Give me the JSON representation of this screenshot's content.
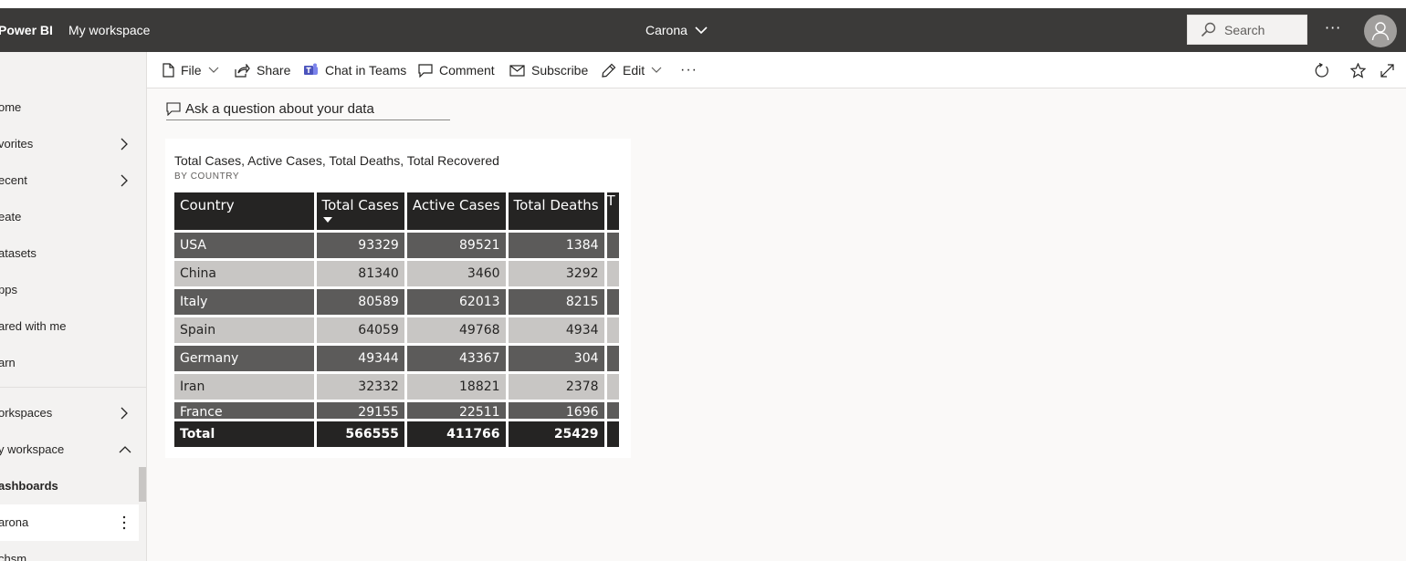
{
  "header": {
    "brand": "Power BI",
    "workspace": "My workspace",
    "report_title": "Carona",
    "search_placeholder": "Search",
    "more": "···"
  },
  "sidebar": {
    "items": [
      {
        "label": "ome"
      },
      {
        "label": "vorites"
      },
      {
        "label": "ecent"
      },
      {
        "label": "eate"
      },
      {
        "label": "atasets"
      },
      {
        "label": "pps"
      },
      {
        "label": "ared with me"
      },
      {
        "label": "arn"
      },
      {
        "label": "orkspaces"
      },
      {
        "label": "y workspace"
      },
      {
        "label": "ashboards"
      },
      {
        "label": "arona"
      },
      {
        "label": "chsm"
      }
    ]
  },
  "toolbar": {
    "file": "File",
    "share": "Share",
    "chat": "Chat in Teams",
    "comment": "Comment",
    "subscribe": "Subscribe",
    "edit": "Edit",
    "more": "···"
  },
  "qna": {
    "placeholder": "Ask a question about your data"
  },
  "tile": {
    "title": "Total Cases, Active Cases, Total Deaths, Total Recovered",
    "subtitle": "BY COUNTRY",
    "columns": [
      "Country",
      "Total Cases",
      "Active Cases",
      "Total Deaths",
      "T"
    ],
    "rows": [
      [
        "USA",
        "93329",
        "89521",
        "1384"
      ],
      [
        "China",
        "81340",
        "3460",
        "3292"
      ],
      [
        "Italy",
        "80589",
        "62013",
        "8215"
      ],
      [
        "Spain",
        "64059",
        "49768",
        "4934"
      ],
      [
        "Germany",
        "49344",
        "43367",
        "304"
      ],
      [
        "Iran",
        "32332",
        "18821",
        "2378"
      ],
      [
        "France",
        "29155",
        "22511",
        "1696"
      ]
    ],
    "total": [
      "Total",
      "566555",
      "411766",
      "25429"
    ]
  },
  "colors": {
    "header_bg": "#3b3a39",
    "row_dark": "#5c5b5a",
    "row_light": "#c8c6c4",
    "table_header": "#252423"
  }
}
